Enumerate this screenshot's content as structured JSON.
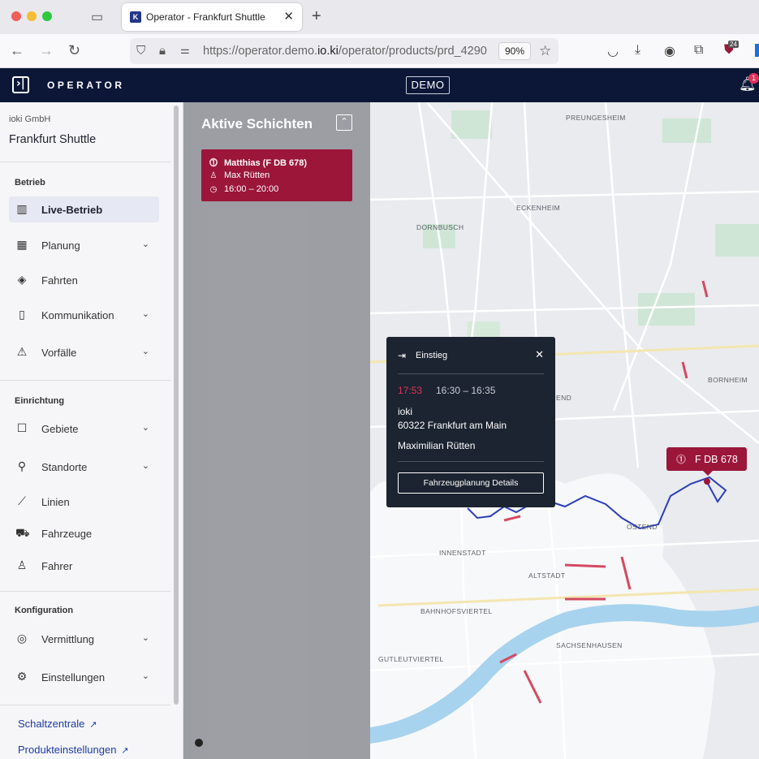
{
  "browser": {
    "tab_title": "Operator - Frankfurt Shuttle",
    "url_prefix": "https://operator.demo.",
    "url_domain": "io.ki",
    "url_suffix": "/operator/products/prd_4290",
    "zoom": "90%",
    "extension_badge": "24"
  },
  "app": {
    "brand": "OPERATOR",
    "env_badge": "DEMO",
    "notification_count": "1"
  },
  "sidebar": {
    "organization": "ioki GmbH",
    "product": "Frankfurt Shuttle",
    "sections": {
      "operations": "Betrieb",
      "setup": "Einrichtung",
      "configuration": "Konfiguration"
    },
    "items": {
      "live": "Live-Betrieb",
      "planning": "Planung",
      "rides": "Fahrten",
      "communication": "Kommunikation",
      "incidents": "Vorfälle",
      "areas": "Gebiete",
      "locations": "Standorte",
      "lines": "Linien",
      "vehicles": "Fahrzeuge",
      "drivers": "Fahrer",
      "dispatch": "Vermittlung",
      "settings": "Einstellungen"
    },
    "links": {
      "control_center": "Schaltzentrale",
      "product_settings": "Produkteinstellungen"
    }
  },
  "shifts": {
    "title": "Aktive Schichten",
    "card": {
      "vehicle": "Matthias (F DB 678)",
      "driver": "Max Rütten",
      "time": "16:00 – 20:00"
    }
  },
  "popup": {
    "heading": "Einstieg",
    "current_time": "17:53",
    "time_window": "16:30 – 16:35",
    "address_line1": "ioki",
    "address_line2": "60322 Frankfurt am Main",
    "passenger": "Maximilian Rütten",
    "button": "Fahrzeugplanung Details"
  },
  "vehicle_marker": {
    "label": "F DB 678"
  },
  "map": {
    "districts": {
      "preungesheim": "PREUNGESHEIM",
      "eckenheim": "ECKENHEIM",
      "dornbusch": "DORNBUSCH",
      "bornheim": "BORNHEIM",
      "ostend": "OSTEND",
      "innenstadt": "INNENSTADT",
      "altstadt": "ALTSTADT",
      "bahnhofsviertel": "BAHNHOFSVIERTEL",
      "gutleutviertel": "GUTLEUTVIERTEL",
      "sachsenhausen": "SACHSENHAUSEN",
      "end_fragment": "END"
    }
  },
  "colors": {
    "app_header": "#0c1738",
    "alert_red": "#9b1639",
    "route_blue": "#2c3fb8",
    "river": "#a7d3ee"
  }
}
